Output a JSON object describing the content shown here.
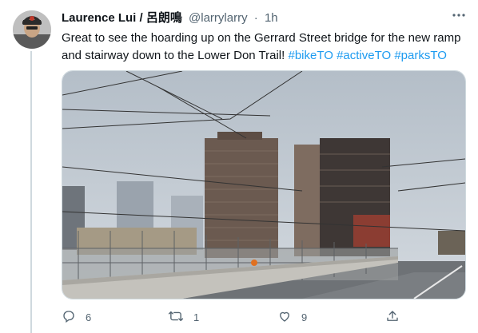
{
  "tweet": {
    "author_name": "Laurence Lui / 呂朗鳴",
    "handle": "@larrylarry",
    "separator": "·",
    "time": "1h",
    "text_before": "Great to see the hoarding up on the Gerrard Street bridge for the new ramp and stairway down to the Lower Don Trail! ",
    "hashtags": [
      "#bikeTO",
      "#activeTO",
      "#parksTO"
    ]
  },
  "actions": {
    "reply_count": "6",
    "retweet_count": "1",
    "like_count": "9",
    "share_count": ""
  },
  "icons": {
    "more": "more-icon",
    "reply": "reply-icon",
    "retweet": "retweet-icon",
    "like": "heart-icon",
    "share": "share-icon"
  },
  "colors": {
    "link": "#1d9bf0",
    "muted": "#536471",
    "thread_line": "#cfd9de"
  }
}
